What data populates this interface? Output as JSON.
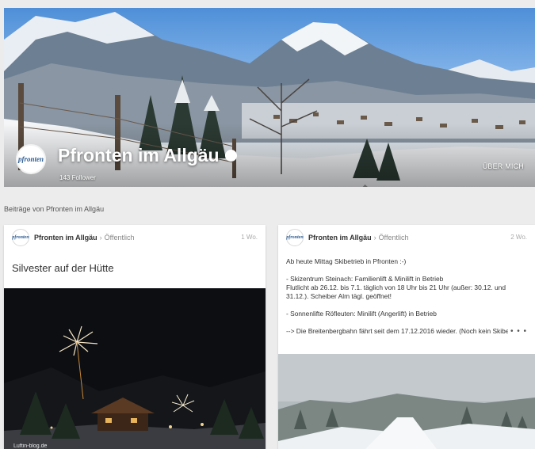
{
  "page": {
    "name": "Pfronten im Allgäu",
    "followers": "143 Follower",
    "about": "ÜBER MICH",
    "avatar_label": "pfronten"
  },
  "section": {
    "header": "Beiträge von Pfronten im Allgäu"
  },
  "posts": [
    {
      "author": "Pfronten im Allgäu",
      "separator": "›",
      "visibility": "Öffentlich",
      "time": "1 Wo.",
      "title": "Silvester auf der Hütte",
      "watermark": "Luftin-blog.de"
    },
    {
      "author": "Pfronten im Allgäu",
      "separator": "›",
      "visibility": "Öffentlich",
      "time": "2 Wo.",
      "body": {
        "line1": "Ab heute Mittag Skibetrieb in Pfronten :-)",
        "line2": "- Skizentrum Steinach: Familienlift & Minilift in Betrieb",
        "line3": "Flutlicht ab 26.12. bis 7.1. täglich von 18 Uhr bis 21 Uhr (außer: 30.12. und 31.12.). Scheiber Alm tägl. geöffnet!",
        "line4": "- Sonnenlifte Röfleuten: Minilift (Angerlift) in Betrieb",
        "line5": "--> Die Breitenbergbahn fährt seit dem 17.12.2016 wieder. (Noch kein Skibetrieb)"
      },
      "more": "• • •"
    }
  ],
  "colors": {
    "sky": "#4f8fd8",
    "card_bg": "#ffffff",
    "page_bg": "#ececec",
    "text_dark": "#333333",
    "text_muted": "#888888"
  }
}
